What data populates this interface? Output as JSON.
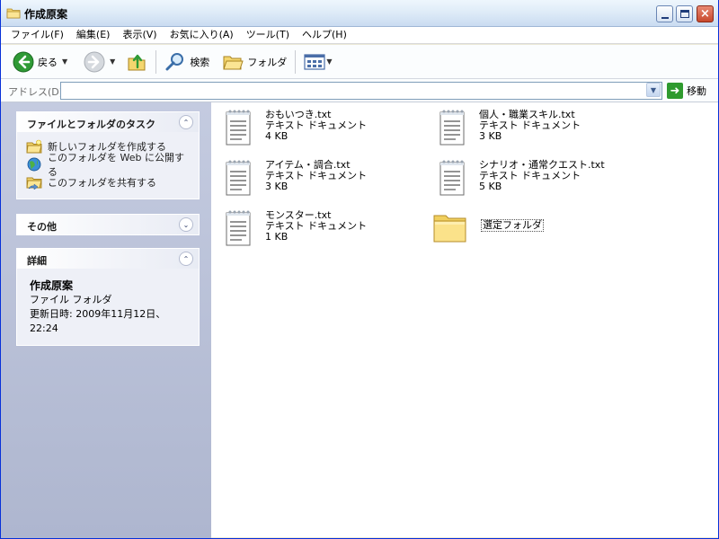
{
  "window": {
    "title": "作成原案",
    "minimize_glyph": "minimize-icon",
    "maximize_glyph": "maximize-icon",
    "close_glyph": "×"
  },
  "menu": [
    "ファイル(F)",
    "編集(E)",
    "表示(V)",
    "お気に入り(A)",
    "ツール(T)",
    "ヘルプ(H)"
  ],
  "toolbar": {
    "back_label": "戻る",
    "search_label": "検索",
    "folders_label": "フォルダ"
  },
  "address": {
    "label": "アドレス(D)",
    "value": "",
    "go_label": "移動"
  },
  "task_pane": {
    "tasks_panel": {
      "title": "ファイルとフォルダのタスク",
      "items": [
        {
          "label": "新しいフォルダを作成する",
          "icon": "new-folder-icon"
        },
        {
          "label": "このフォルダを Web に公開する",
          "icon": "publish-web-icon"
        },
        {
          "label": "このフォルダを共有する",
          "icon": "share-folder-icon"
        }
      ]
    },
    "other_panel": {
      "title": "その他"
    },
    "details_panel": {
      "title": "詳細",
      "name": "作成原案",
      "type": "ファイル フォルダ",
      "modified": "更新日時: 2009年11月12日、22:24"
    }
  },
  "files": [
    {
      "name": "おもいつき.txt",
      "type": "テキスト ドキュメント",
      "size": "4 KB",
      "icon": "text-document-icon"
    },
    {
      "name": "個人・職業スキル.txt",
      "type": "テキスト ドキュメント",
      "size": "3 KB",
      "icon": "text-document-icon"
    },
    {
      "name": "アイテム・調合.txt",
      "type": "テキスト ドキュメント",
      "size": "3 KB",
      "icon": "text-document-icon"
    },
    {
      "name": "シナリオ・通常クエスト.txt",
      "type": "テキスト ドキュメント",
      "size": "5 KB",
      "icon": "text-document-icon"
    },
    {
      "name": "モンスター.txt",
      "type": "テキスト ドキュメント",
      "size": "1 KB",
      "icon": "text-document-icon"
    },
    {
      "name": "選定フォルダ",
      "icon": "folder-icon"
    }
  ],
  "colors": {
    "titlebar": "#dfecf8",
    "taskpane": "#aeb6cf",
    "go_green": "#2e9a2e"
  }
}
